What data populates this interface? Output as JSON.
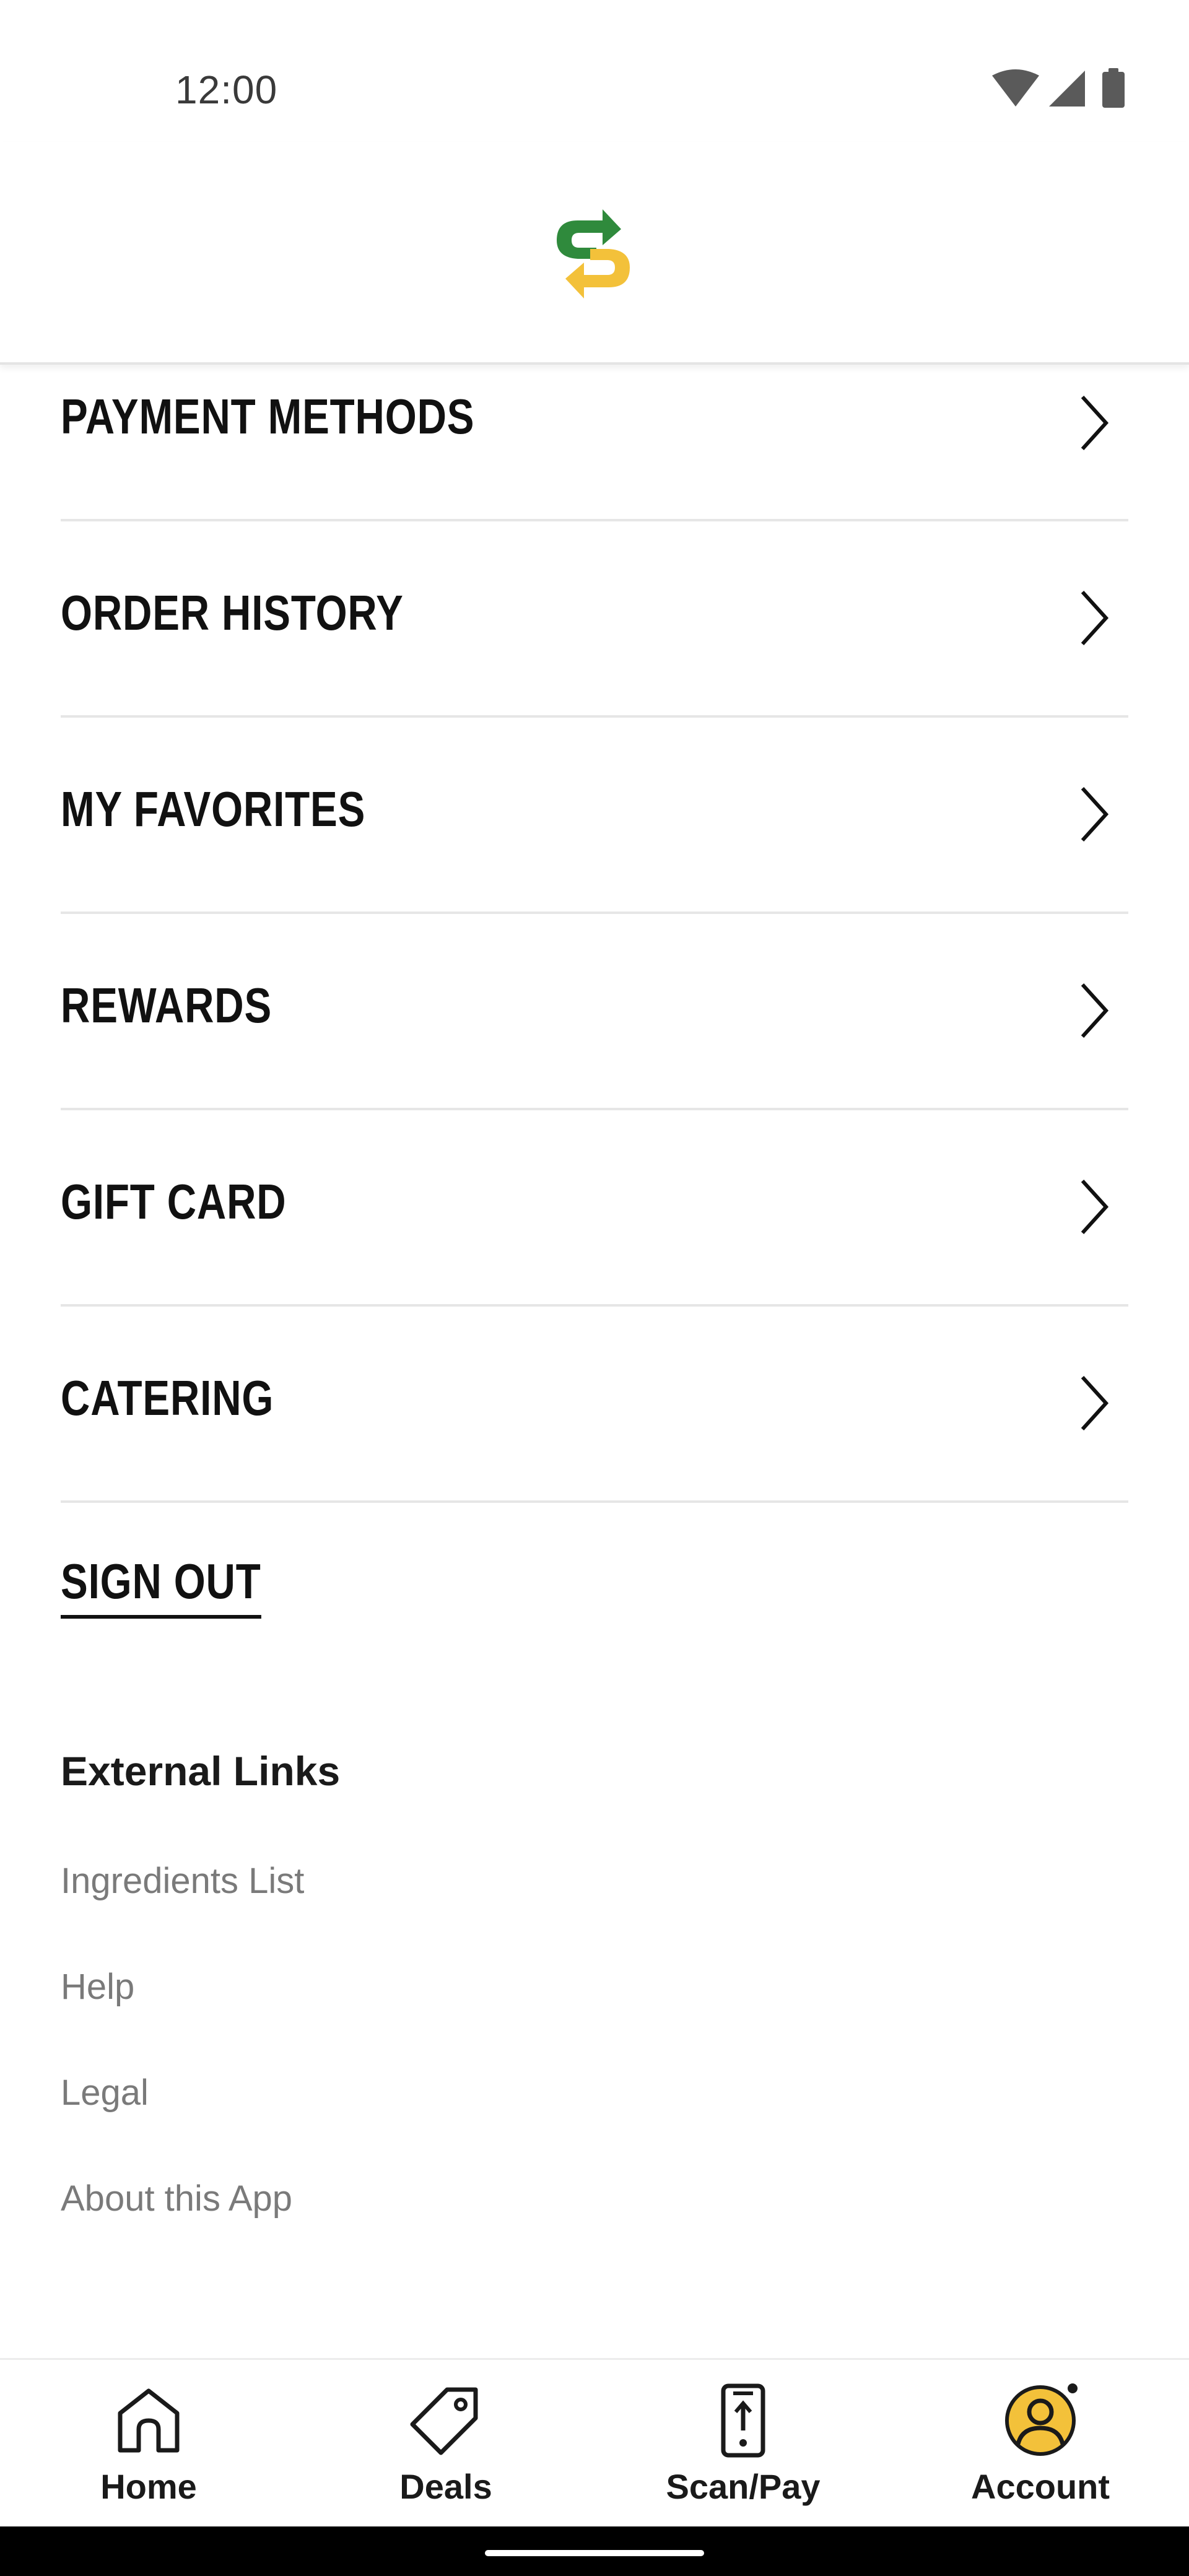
{
  "status_bar": {
    "time": "12:00",
    "icons": [
      "wifi-icon",
      "signal-icon",
      "battery-icon"
    ]
  },
  "header": {
    "logo": "subway-logo-icon",
    "logo_colors": {
      "green": "#2f8a3c",
      "yellow": "#f3c13a"
    }
  },
  "menu": {
    "items": [
      {
        "label": "PAYMENT METHODS"
      },
      {
        "label": "ORDER HISTORY"
      },
      {
        "label": "MY FAVORITES"
      },
      {
        "label": "REWARDS"
      },
      {
        "label": "GIFT CARD"
      },
      {
        "label": "CATERING"
      }
    ]
  },
  "sign_out_label": "SIGN OUT",
  "external": {
    "title": "External Links",
    "links": [
      {
        "label": "Ingredients List"
      },
      {
        "label": "Help"
      },
      {
        "label": "Legal"
      },
      {
        "label": "About this App"
      }
    ]
  },
  "bottom_nav": {
    "items": [
      {
        "label": "Home",
        "icon": "home-icon"
      },
      {
        "label": "Deals",
        "icon": "tag-icon"
      },
      {
        "label": "Scan/Pay",
        "icon": "phone-scan-icon"
      },
      {
        "label": "Account",
        "icon": "account-icon",
        "selected": true
      }
    ],
    "accent": "#f3c13a"
  }
}
